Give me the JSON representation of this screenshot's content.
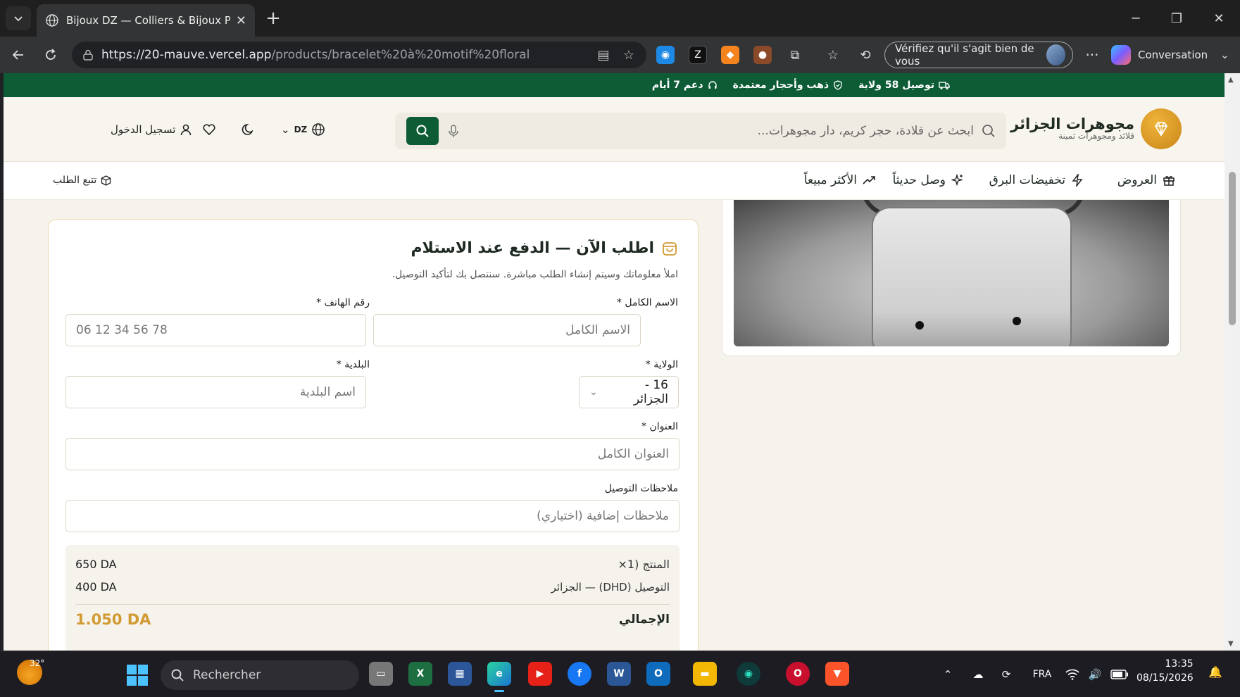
{
  "browser": {
    "tab_title": "Bijoux DZ — Colliers & Bijoux Préc",
    "url_host": "https://20-mauve.vercel.app",
    "url_path": "/products/bracelet%20à%20motif%20floral",
    "verify_label": "Vérifiez qu'il s'agit bien de vous",
    "conversation_label": "Conversation"
  },
  "promo": {
    "delivery": "توصيل 58 ولاية",
    "gold": "ذهب وأحجار معتمدة",
    "support": "دعم 7 أيام"
  },
  "header": {
    "brand_name": "مجوهرات الجزائر",
    "brand_tagline": "قلائد ومجوهرات ثمينة",
    "search_placeholder": "ابحث عن قلادة، حجر كريم، دار مجوهرات...",
    "currency": "DZ",
    "login_label": "تسجيل الدخول"
  },
  "nav": {
    "offers": "العروض",
    "flash": "تخفيضات البرق",
    "new": "وصل حديثاً",
    "bestsellers": "الأكثر مبيعاً",
    "track": "تتبع الطلب"
  },
  "order": {
    "title": "اطلب الآن — الدفع عند الاستلام",
    "subtitle": "املأ معلوماتك وسيتم إنشاء الطلب مباشرة. سنتصل بك لتأكيد التوصيل.",
    "fullname_label": "الاسم الكامل *",
    "fullname_placeholder": "الاسم الكامل",
    "phone_label": "رقم الهاتف *",
    "phone_placeholder": "06 12 34 56 78",
    "wilaya_label": "الولاية *",
    "wilaya_value": "16 - الجزائر",
    "commune_label": "البلدية *",
    "commune_placeholder": "اسم البلدية",
    "address_label": "العنوان *",
    "address_placeholder": "العنوان الكامل",
    "notes_label": "ملاحظات التوصيل",
    "notes_placeholder": "ملاحظات إضافية (اختياري)",
    "summary": {
      "product_label": "المنتج (1×",
      "product_value": "650 DA",
      "shipping_label": "التوصيل (DHD) — الجزائر",
      "shipping_value": "400 DA",
      "total_label": "الإجمالي",
      "total_value": "1.050 DA"
    }
  },
  "taskbar": {
    "temperature": "32°",
    "search_label": "Rechercher",
    "lang": "FRA",
    "time": "13:35",
    "date": "08/15/2026"
  },
  "colors": {
    "brand_green": "#0d5c36",
    "gold": "#d19a32",
    "page_bg": "#f6f3ed"
  }
}
